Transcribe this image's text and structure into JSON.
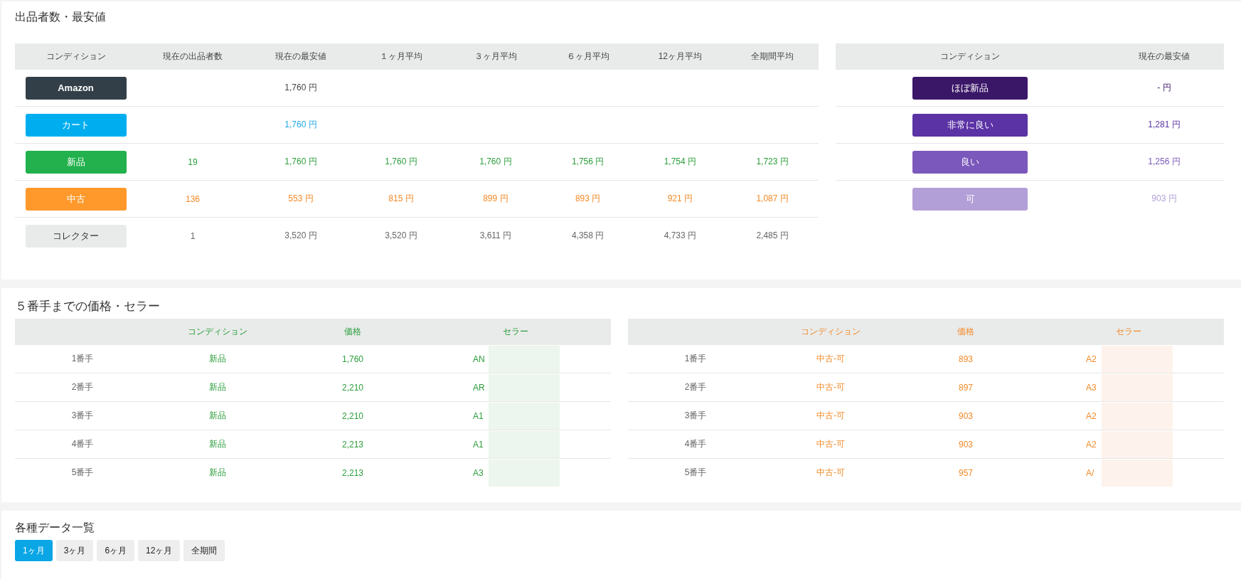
{
  "offers": {
    "title": "出品者数・最安値",
    "main_table": {
      "columns": [
        "コンディション",
        "現在の出品者数",
        "現在の最安値",
        "１ヶ月平均",
        "３ヶ月平均",
        "６ヶ月平均",
        "12ヶ月平均",
        "全期間平均"
      ],
      "rows": [
        {
          "kind": "amazon",
          "cells": [
            "Amazon",
            null,
            "1,760 円",
            null,
            null,
            null,
            null,
            null
          ]
        },
        {
          "kind": "cart",
          "cells": [
            "カート",
            null,
            "1,760 円",
            null,
            null,
            null,
            null,
            null
          ]
        },
        {
          "kind": "new",
          "cells": [
            "新品",
            "19",
            "1,760 円",
            "1,760 円",
            "1,760 円",
            "1,756 円",
            "1,754 円",
            "1,723 円"
          ]
        },
        {
          "kind": "used",
          "cells": [
            "中古",
            "136",
            "553 円",
            "815 円",
            "899 円",
            "893 円",
            "921 円",
            "1,087 円"
          ]
        },
        {
          "kind": "collector",
          "cells": [
            "コレクター",
            "1",
            "3,520 円",
            "3,520 円",
            "3,611 円",
            "4,358 円",
            "4,733 円",
            "2,485 円"
          ]
        }
      ]
    },
    "used_table": {
      "columns": [
        "コンディション",
        "現在の最安値"
      ],
      "rows": [
        {
          "kind": "like-new",
          "condition": "ほぼ新品",
          "price": "- 円"
        },
        {
          "kind": "very-good",
          "condition": "非常に良い",
          "price": "1,281 円"
        },
        {
          "kind": "good",
          "condition": "良い",
          "price": "1,256 円"
        },
        {
          "kind": "acceptable",
          "condition": "可",
          "price": "903 円"
        }
      ]
    }
  },
  "top_sellers": {
    "title": "５番手までの価格・セラー",
    "tables": [
      {
        "kind": "new",
        "columns": [
          "コンディション",
          "価格",
          "セラー"
        ],
        "rows": [
          {
            "rank": "1番手",
            "condition": "新品",
            "price": "1,760",
            "seller": "AN"
          },
          {
            "rank": "2番手",
            "condition": "新品",
            "price": "2,210",
            "seller": "AR"
          },
          {
            "rank": "3番手",
            "condition": "新品",
            "price": "2,210",
            "seller": "A1"
          },
          {
            "rank": "4番手",
            "condition": "新品",
            "price": "2,213",
            "seller": "A1"
          },
          {
            "rank": "5番手",
            "condition": "新品",
            "price": "2,213",
            "seller": "A3"
          }
        ]
      },
      {
        "kind": "used",
        "columns": [
          "コンディション",
          "価格",
          "セラー"
        ],
        "rows": [
          {
            "rank": "1番手",
            "condition": "中古-可",
            "price": "893",
            "seller": "A2"
          },
          {
            "rank": "2番手",
            "condition": "中古-可",
            "price": "897",
            "seller": "A3"
          },
          {
            "rank": "3番手",
            "condition": "中古-可",
            "price": "903",
            "seller": "A2"
          },
          {
            "rank": "4番手",
            "condition": "中古-可",
            "price": "903",
            "seller": "A2"
          },
          {
            "rank": "5番手",
            "condition": "中古-可",
            "price": "957",
            "seller": "A/"
          }
        ]
      }
    ]
  },
  "data_list": {
    "title": "各種データ一覧",
    "tabs": [
      {
        "label": "1ヶ月",
        "selected": true
      },
      {
        "label": "3ヶ月",
        "selected": false
      },
      {
        "label": "6ヶ月",
        "selected": false
      },
      {
        "label": "12ヶ月",
        "selected": false
      },
      {
        "label": "全期間",
        "selected": false
      }
    ]
  }
}
